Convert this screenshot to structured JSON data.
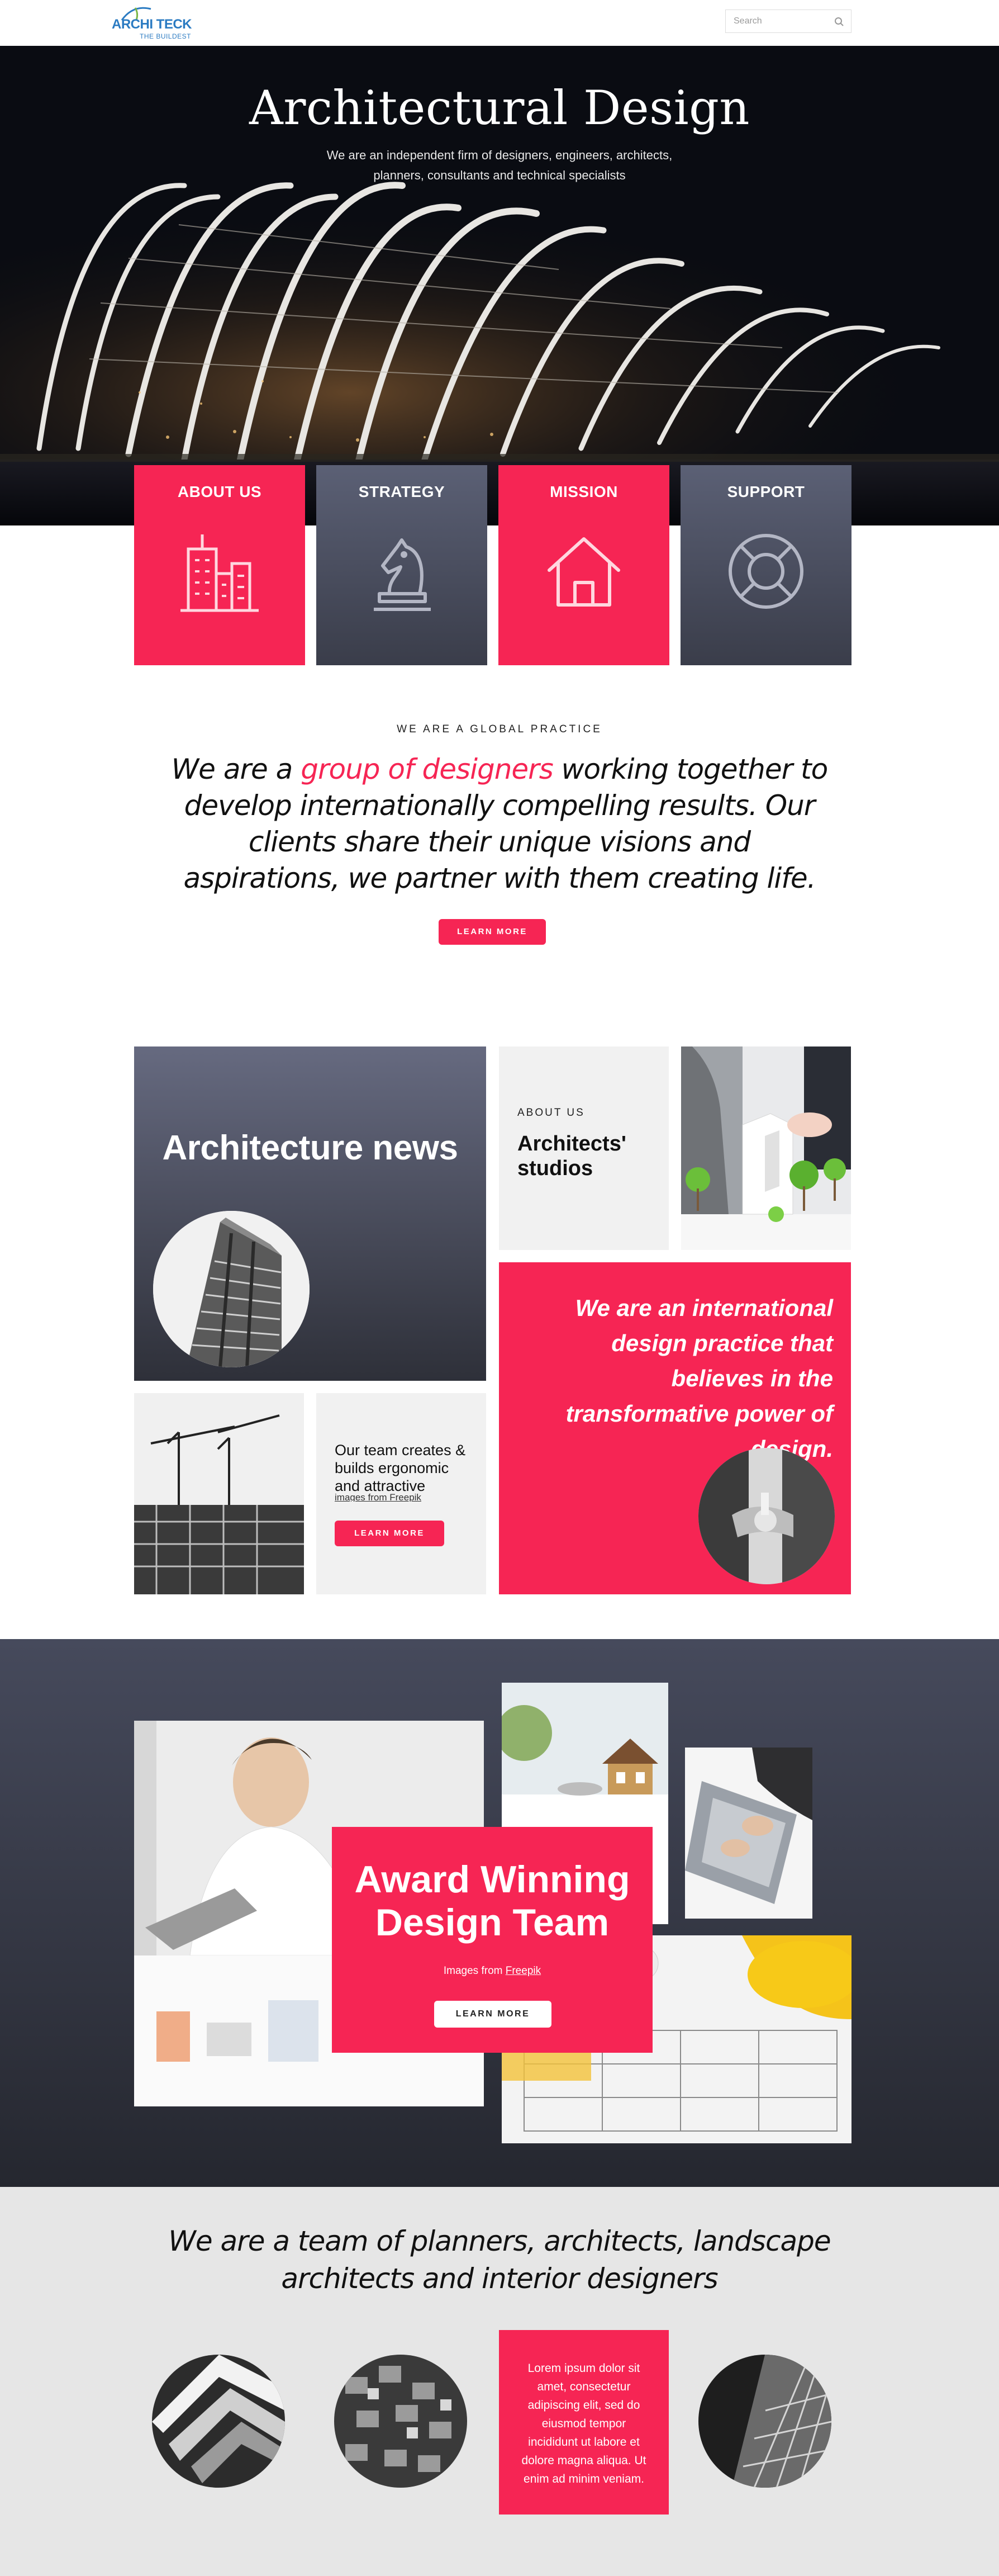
{
  "header": {
    "logo_text": "ARCHI TECK",
    "logo_sub": "THE BUILDEST",
    "search_placeholder": "Search"
  },
  "hero": {
    "title": "Architectural Design",
    "subtitle": "We are an independent firm of designers, engineers, architects, planners, consultants and technical specialists"
  },
  "cards": [
    {
      "label": "ABOUT US",
      "icon": "building-icon",
      "color": "#f62554"
    },
    {
      "label": "STRATEGY",
      "icon": "chess-knight-icon",
      "color": "#4a4e60"
    },
    {
      "label": "MISSION",
      "icon": "house-icon",
      "color": "#f62554"
    },
    {
      "label": "SUPPORT",
      "icon": "lifebuoy-icon",
      "color": "#4a4e60"
    }
  ],
  "practice": {
    "kicker": "WE ARE A GLOBAL PRACTICE",
    "statement_pre": "We are a ",
    "statement_highlight": "group of designers",
    "statement_post": " working together to develop internationally compelling results. Our clients share their unique visions and aspirations, we partner with them creating life.",
    "button": "LEARN MORE"
  },
  "news": {
    "title": "Architecture news",
    "studio_kicker": "ABOUT US",
    "studio_title": "Architects' studios",
    "intl_text": "We are an international design practice that believes in the transformative power of design.",
    "team_text": "Our team creates & builds ergonomic and attractive",
    "team_overflow": "images from Freepik",
    "team_button": "LEARN MORE"
  },
  "award": {
    "title": "Award Winning Design Team",
    "credit_pre": "Images from ",
    "credit_link": "Freepik",
    "button": "LEARN MORE"
  },
  "team": {
    "heading": "We are a team of planners, architects, landscape architects and interior designers",
    "lorem": "Lorem ipsum dolor sit amet, consectetur adipiscing elit, sed do eiusmod tempor incididunt ut labore et dolore magna aliqua. Ut enim ad minim veniam."
  },
  "colors": {
    "accent": "#f62554",
    "slate": "#4a4e60",
    "light_gray": "#f1f1f1"
  }
}
